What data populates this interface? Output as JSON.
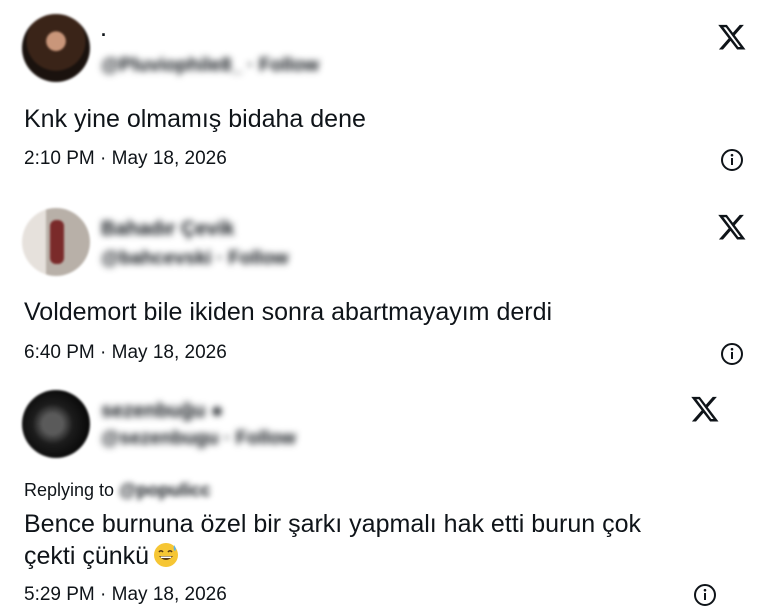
{
  "tweets": [
    {
      "name": ".",
      "handle": "@Pluviophile8_ · Follow",
      "text": "Knk yine olmamış bidaha dene",
      "time": "2:10 PM · May 18, 2026"
    },
    {
      "name": "Bahadır Çevik",
      "handle": "@bahcevski · Follow",
      "text": "Voldemort bile ikiden sonra abartmayayım derdi",
      "time": "6:40 PM · May 18, 2026"
    },
    {
      "name": "sezenbuğu ●",
      "handle": "@sezenbugu · Follow",
      "replying_label": "Replying to",
      "replying_handle": "@populicc",
      "text_line1": "Bence burnuna özel bir şarkı yapmalı hak etti burun çok",
      "text_line2": "çekti çünkü",
      "time": "5:29 PM · May 18, 2026"
    }
  ],
  "icons": {
    "brand": "x-logo-icon",
    "info": "info-icon",
    "emoji": "grinning-sweat-emoji-icon"
  },
  "colors": {
    "text": "#0f1419",
    "emoji": "#f6c634"
  }
}
